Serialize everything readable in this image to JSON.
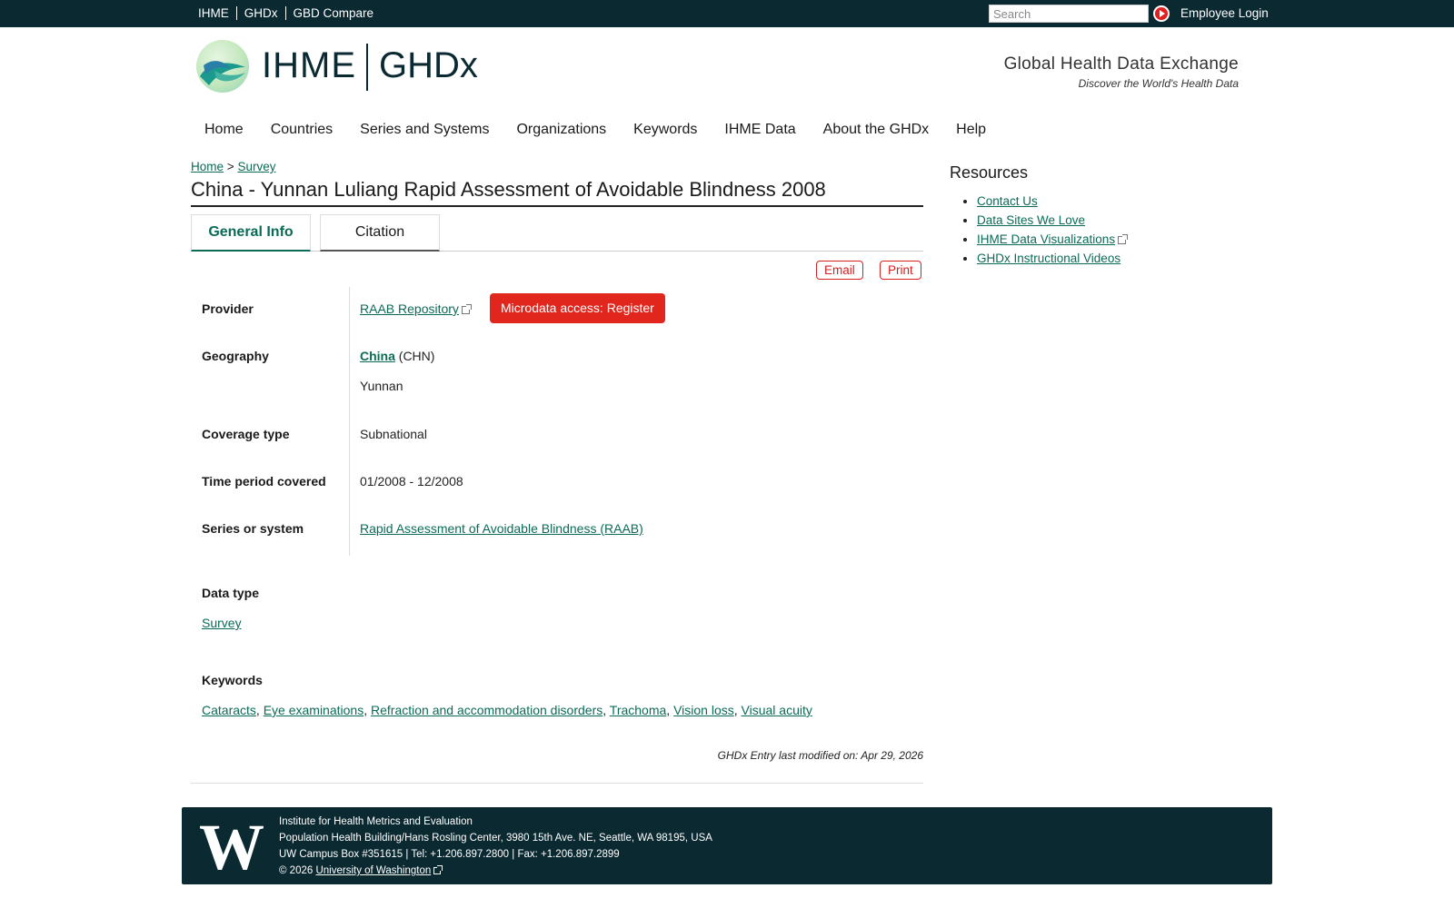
{
  "topbar": {
    "links": [
      "IHME",
      "GHDx",
      "GBD Compare"
    ],
    "search_placeholder": "Search",
    "employee_login": "Employee Login"
  },
  "header": {
    "logo_ihme": "IHME",
    "logo_ghdx": "GHDx",
    "tagline_main": "Global Health Data Exchange",
    "tagline_sub": "Discover the World's Health Data"
  },
  "nav": {
    "items": [
      "Home",
      "Countries",
      "Series and Systems",
      "Organizations",
      "Keywords",
      "IHME Data",
      "About the GHDx",
      "Help"
    ]
  },
  "breadcrumb": {
    "home": "Home",
    "separator": ">",
    "current": "Survey"
  },
  "page": {
    "title": "China - Yunnan Luliang Rapid Assessment of Avoidable Blindness 2008",
    "tabs": [
      "General Info",
      "Citation"
    ],
    "active_tab": "General Info",
    "email_label": "Email",
    "print_label": "Print"
  },
  "fields": {
    "provider_label": "Provider",
    "provider_value": "RAAB Repository",
    "register_button": "Microdata access: Register",
    "geography_label": "Geography",
    "geography_country": "China",
    "geography_code": "(CHN)",
    "geography_region": "Yunnan",
    "coverage_label": "Coverage type",
    "coverage_value": "Subnational",
    "time_label": "Time period covered",
    "time_value": "01/2008 - 12/2008",
    "series_label": "Series or system",
    "series_value": "Rapid Assessment of Avoidable Blindness (RAAB)",
    "datatype_label": "Data type",
    "datatype_value": "Survey",
    "keywords_label": "Keywords",
    "keywords": [
      "Cataracts",
      "Eye examinations",
      "Refraction and accommodation disorders",
      "Trachoma",
      "Vision loss",
      "Visual acuity"
    ],
    "keyword_separator": ",",
    "modified": "GHDx Entry last modified on: Apr 29, 2026"
  },
  "sidebar": {
    "title": "Resources",
    "items": [
      "Contact Us",
      "Data Sites We Love",
      "IHME Data Visualizations",
      "GHDx Instructional Videos"
    ]
  },
  "footer": {
    "line1": "Institute for Health Metrics and Evaluation",
    "line2": "Population Health Building/Hans Rosling Center, 3980 15th Ave. NE, Seattle, WA 98195, USA",
    "line3": "UW Campus Box #351615 | Tel: +1.206.897.2800 | Fax: +1.206.897.2899",
    "copyright": "© 2026",
    "uw_link": "University of Washington",
    "logo_letter": "W"
  },
  "colors": {
    "dark_bar": "#0b2931",
    "link": "#0b6b57",
    "accent_red": "#e0261d"
  }
}
